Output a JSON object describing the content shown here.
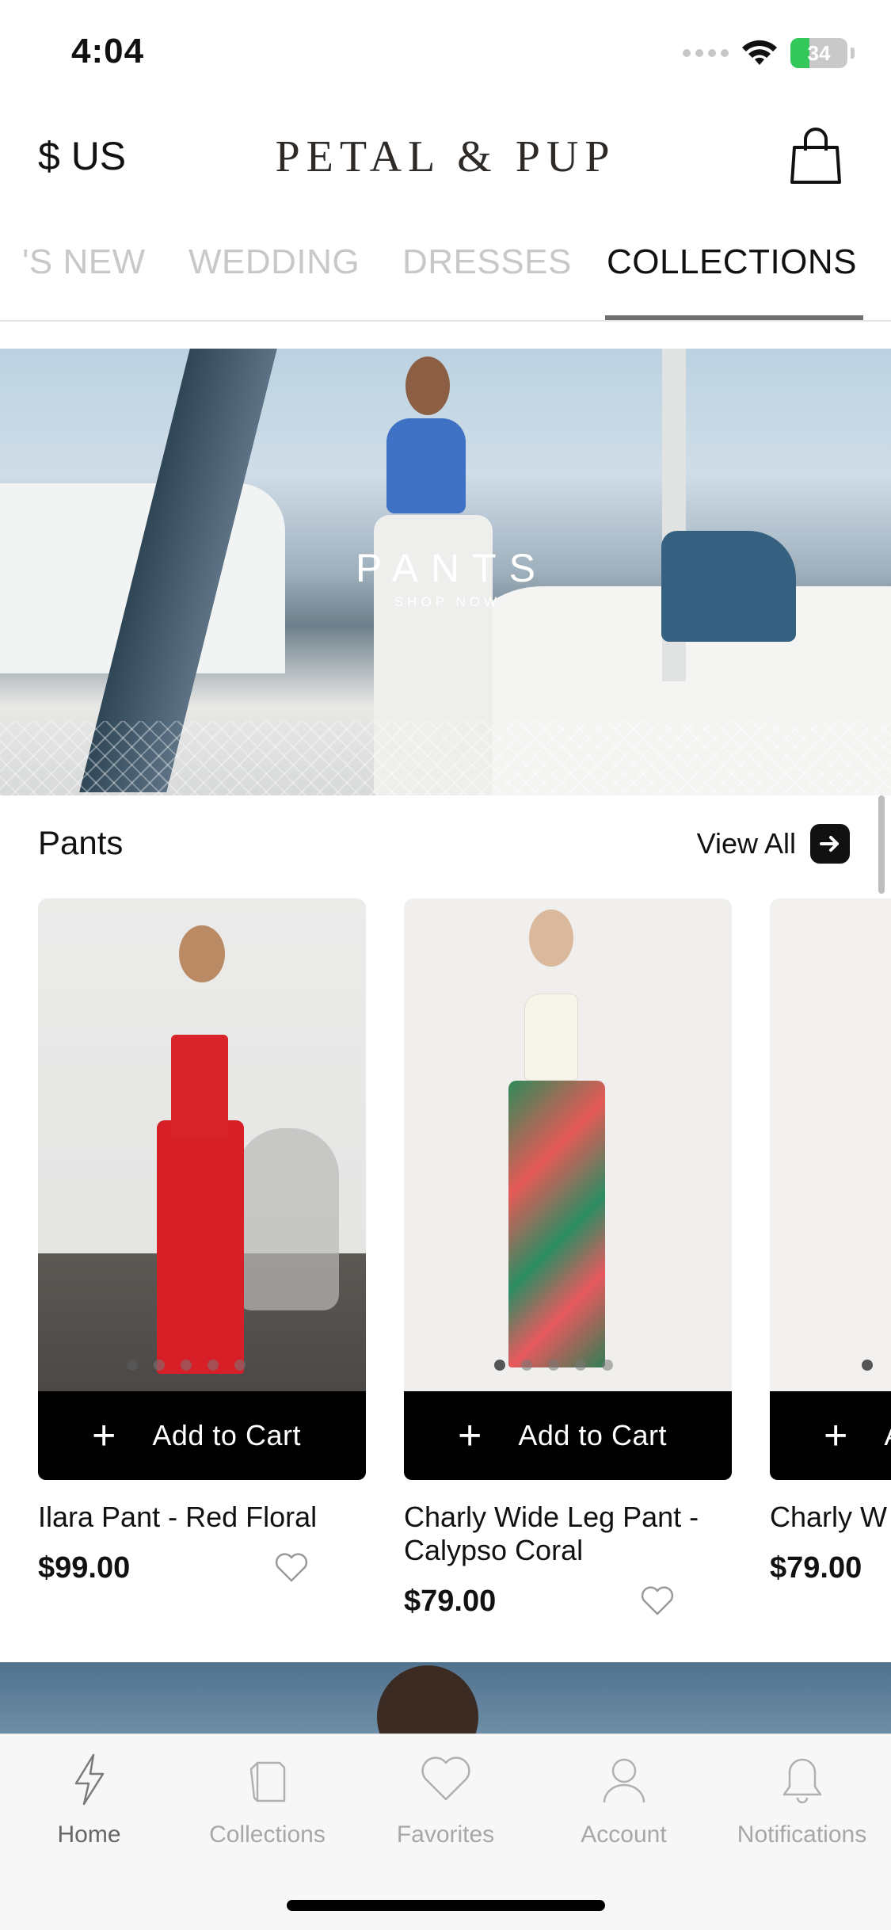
{
  "status_bar": {
    "time": "4:04",
    "battery": "34"
  },
  "header": {
    "currency": "$ US",
    "brand": "PETAL & PUP"
  },
  "category_tabs": [
    {
      "label": "'S NEW"
    },
    {
      "label": "WEDDING"
    },
    {
      "label": "DRESSES"
    },
    {
      "label": "COLLECTIONS",
      "active": true
    }
  ],
  "hero": {
    "title": "PANTS",
    "subtitle": "SHOP NOW"
  },
  "section": {
    "title": "Pants",
    "view_all": "View All"
  },
  "products": [
    {
      "name": "Ilara Pant - Red Floral",
      "price": "$99.00",
      "add_to_cart": "Add to Cart"
    },
    {
      "name": "Charly Wide Leg Pant - Calypso Coral",
      "price": "$79.00",
      "add_to_cart": "Add to Cart"
    },
    {
      "name": "Charly W Bel Air Ro",
      "price": "$79.00",
      "add_to_cart": "Add to Cart"
    }
  ],
  "tab_bar": [
    {
      "label": "Home",
      "icon": "lightning-icon",
      "active": true
    },
    {
      "label": "Collections",
      "icon": "collections-icon"
    },
    {
      "label": "Favorites",
      "icon": "heart-icon"
    },
    {
      "label": "Account",
      "icon": "person-icon"
    },
    {
      "label": "Notifications",
      "icon": "bell-icon"
    }
  ],
  "colors": {
    "accent": "#000000",
    "battery_green": "#34c759",
    "inactive_tab": "#c8c8c8"
  }
}
